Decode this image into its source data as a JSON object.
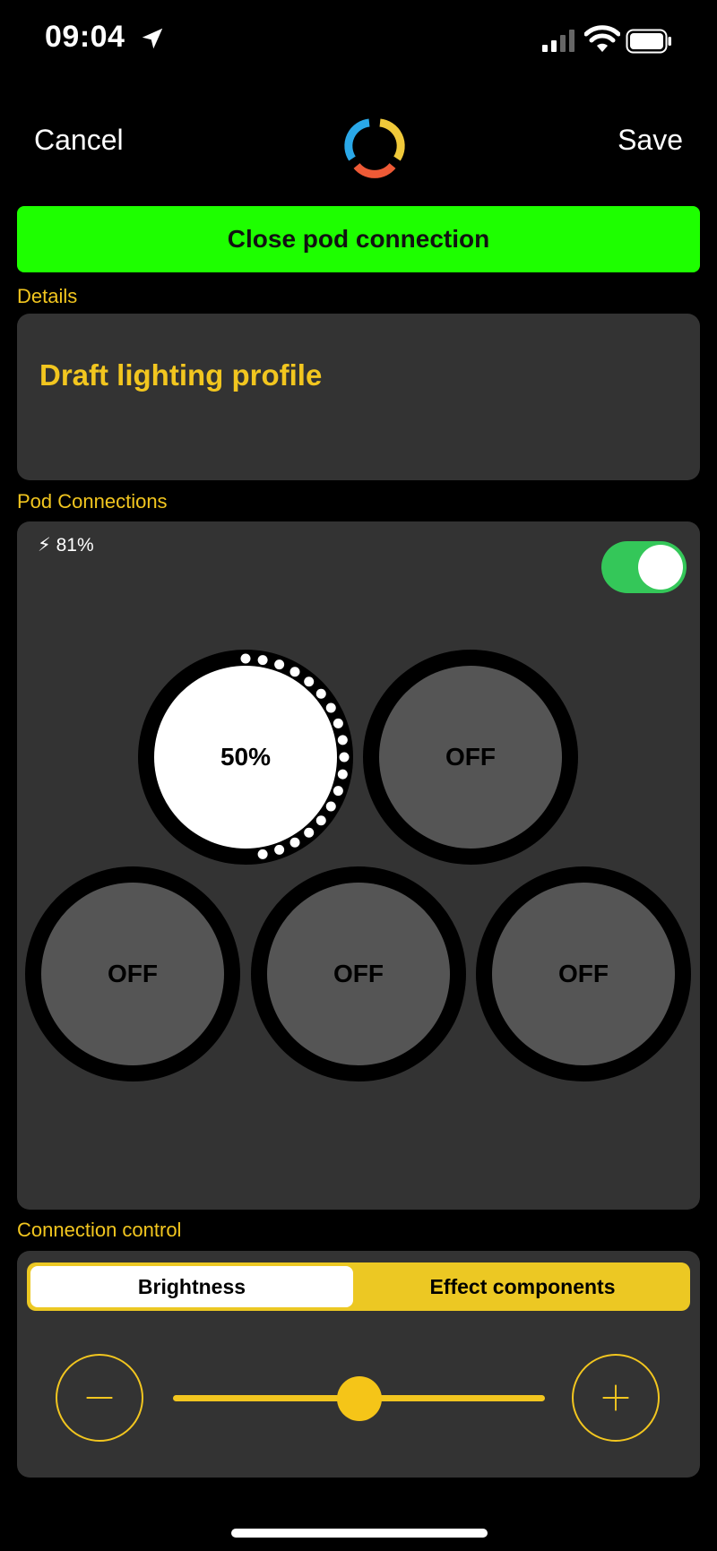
{
  "status_bar": {
    "time": "09:04",
    "icons": [
      "location-arrow-icon",
      "cellular-signal-icon",
      "wifi-icon",
      "battery-icon"
    ]
  },
  "nav": {
    "cancel_label": "Cancel",
    "save_label": "Save",
    "logo_icon": "app-logo-icon"
  },
  "close_button_label": "Close pod connection",
  "details": {
    "section_label": "Details",
    "profile_name": "Draft lighting profile"
  },
  "pod_connections": {
    "section_label": "Pod Connections",
    "battery_text": "⚡︎ 81%",
    "toggle_on": true,
    "pods": [
      {
        "label": "50%",
        "on": true,
        "brightness": 0.5
      },
      {
        "label": "OFF",
        "on": false
      },
      {
        "label": "OFF",
        "on": false
      },
      {
        "label": "OFF",
        "on": false
      },
      {
        "label": "OFF",
        "on": false
      }
    ]
  },
  "connection_control": {
    "section_label": "Connection control",
    "tabs": [
      {
        "label": "Brightness",
        "selected": true
      },
      {
        "label": "Effect components",
        "selected": false
      }
    ],
    "slider_value": 0.5,
    "minus_icon": "minus-icon",
    "plus_icon": "plus-icon"
  },
  "colors": {
    "accent_yellow": "#f2c61f",
    "close_green": "#1eff00",
    "toggle_green": "#34c759",
    "card_gray": "#333333",
    "pod_off_gray": "#555555"
  }
}
